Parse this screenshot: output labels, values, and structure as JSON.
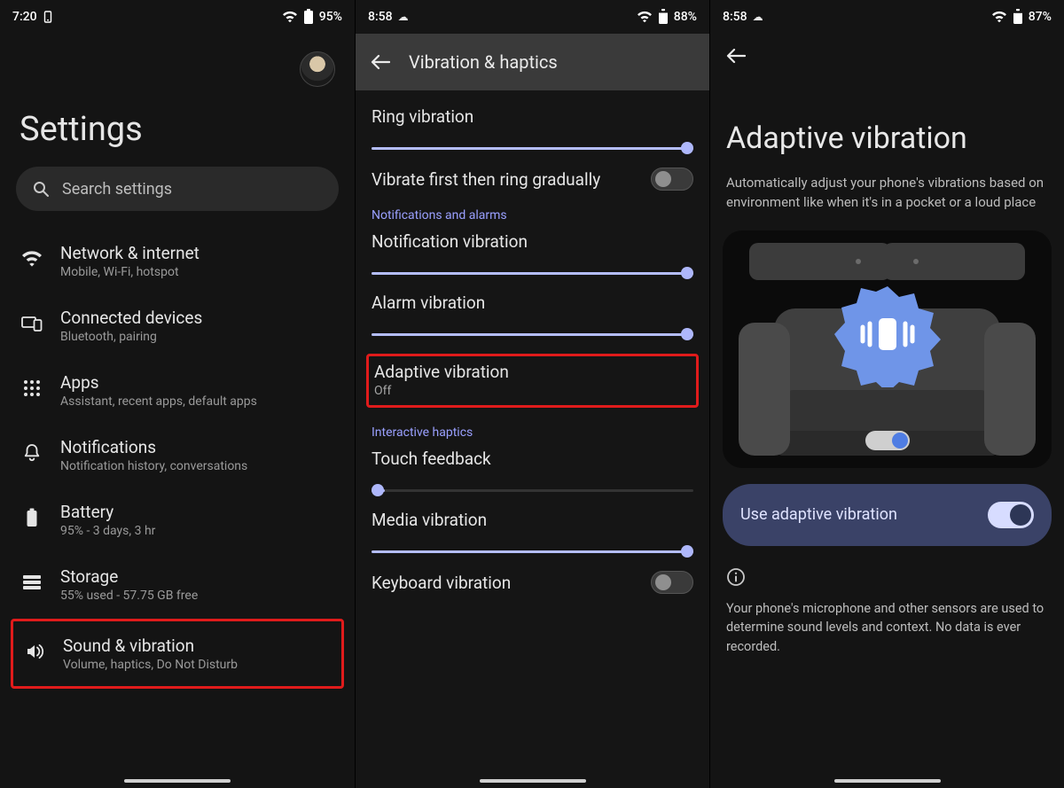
{
  "panel1": {
    "status": {
      "time": "7:20",
      "battery": "95%"
    },
    "title": "Settings",
    "search_placeholder": "Search settings",
    "items": [
      {
        "title": "Network & internet",
        "subtitle": "Mobile, Wi-Fi, hotspot"
      },
      {
        "title": "Connected devices",
        "subtitle": "Bluetooth, pairing"
      },
      {
        "title": "Apps",
        "subtitle": "Assistant, recent apps, default apps"
      },
      {
        "title": "Notifications",
        "subtitle": "Notification history, conversations"
      },
      {
        "title": "Battery",
        "subtitle": "95% - 3 days, 3 hr"
      },
      {
        "title": "Storage",
        "subtitle": "55% used - 57.75 GB free"
      },
      {
        "title": "Sound & vibration",
        "subtitle": "Volume, haptics, Do Not Disturb"
      }
    ]
  },
  "panel2": {
    "status": {
      "time": "8:58",
      "battery": "88%"
    },
    "header": "Vibration & haptics",
    "ring": {
      "label": "Ring vibration",
      "value": 100
    },
    "vib_first": {
      "label": "Vibrate first then ring gradually",
      "on": false
    },
    "section_notif": "Notifications and alarms",
    "notif": {
      "label": "Notification vibration",
      "value": 100
    },
    "alarm": {
      "label": "Alarm vibration",
      "value": 100
    },
    "adaptive": {
      "label": "Adaptive vibration",
      "state": "Off"
    },
    "section_interactive": "Interactive haptics",
    "touch": {
      "label": "Touch feedback",
      "value": 4
    },
    "media": {
      "label": "Media vibration",
      "value": 100
    },
    "keyboard": {
      "label": "Keyboard vibration",
      "on": false
    }
  },
  "panel3": {
    "status": {
      "time": "8:58",
      "battery": "87%"
    },
    "title": "Adaptive vibration",
    "subtitle": "Automatically adjust your phone's vibrations based on environment like when it's in a pocket or a loud place",
    "use_label": "Use adaptive vibration",
    "use_on": true,
    "note": "Your phone's microphone and other sensors are used to determine sound levels and context. No data is ever recorded."
  }
}
